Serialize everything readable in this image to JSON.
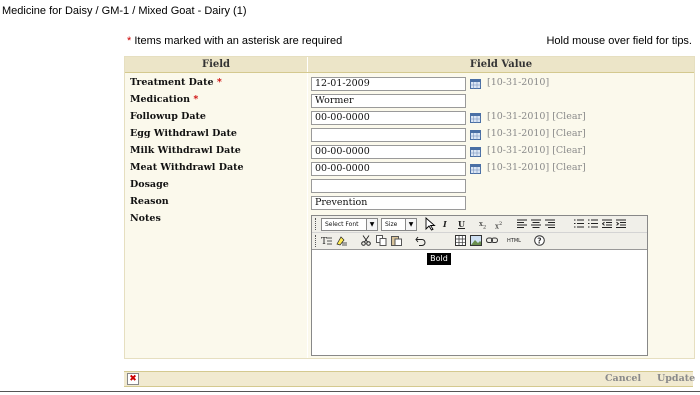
{
  "page": {
    "title": "Medicine for Daisy / GM-1 / Mixed Goat - Dairy (1)",
    "required_star": "*",
    "required_note": " Items marked with an asterisk are required",
    "hover_tip": "Hold mouse over field for tips."
  },
  "table": {
    "col_field": "Field",
    "col_value": "Field Value"
  },
  "fields": [
    {
      "label": "Treatment Date",
      "required": "*",
      "value": "12-01-2009",
      "hint": "[10-31-2010]"
    },
    {
      "label": "Medication",
      "required": "*",
      "value": "Wormer"
    },
    {
      "label": "Followup Date",
      "value": "00-00-0000",
      "hint": "[10-31-2010] [Clear]"
    },
    {
      "label": "Egg Withdrawl Date",
      "value": "",
      "hint": "[10-31-2010] [Clear]"
    },
    {
      "label": "Milk Withdrawl Date",
      "value": "00-00-0000",
      "hint": "[10-31-2010] [Clear]"
    },
    {
      "label": "Meat Withdrawl Date",
      "value": "00-00-0000",
      "hint": "[10-31-2010] [Clear]"
    },
    {
      "label": "Dosage",
      "value": ""
    },
    {
      "label": "Reason",
      "value": "Prevention"
    },
    {
      "label": "Notes"
    }
  ],
  "editor": {
    "font_select": "Select Font",
    "size_select": "Size",
    "italic": "I",
    "underline": "U",
    "html_button": "HTML",
    "tooltip": "Bold"
  },
  "footer": {
    "cancel": "Cancel",
    "update": "Update"
  },
  "colors": {
    "accent_required": "#cc0000",
    "header_bg": "#ece5c8",
    "form_bg": "#fbf9ec"
  }
}
